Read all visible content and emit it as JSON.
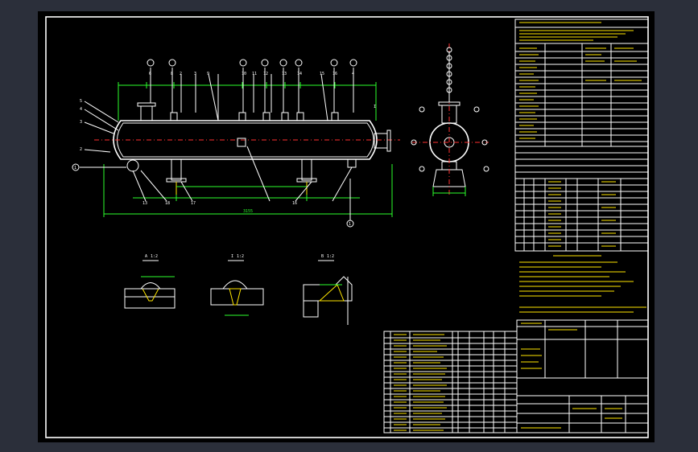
{
  "colors": {
    "background": "#2b2f3a",
    "canvas": "#000000",
    "line": "#ffffff",
    "accent": "#ffe600",
    "dim": "#2bff2b",
    "center": "#ff3030"
  },
  "elevation": {
    "top_balloons": [
      "6",
      "8",
      "2",
      "3",
      "9",
      "10",
      "11",
      "12",
      "13",
      "14",
      "15",
      "16",
      "4"
    ],
    "left_balloons": [
      "5",
      "4",
      "3",
      "2",
      "1"
    ],
    "bottom_balloons": [
      "13",
      "18",
      "17",
      "16",
      "1"
    ],
    "overall_length": "3155",
    "right_mark": "I"
  },
  "side_view": {
    "top_balloons": [
      "1",
      "2",
      "3",
      "4",
      "5",
      "6",
      "7",
      "8",
      "9"
    ]
  },
  "details": [
    {
      "label": "A",
      "scale": "1:2"
    },
    {
      "label": "I",
      "scale": "1:2"
    },
    {
      "label": "B",
      "scale": "1:2"
    }
  ]
}
